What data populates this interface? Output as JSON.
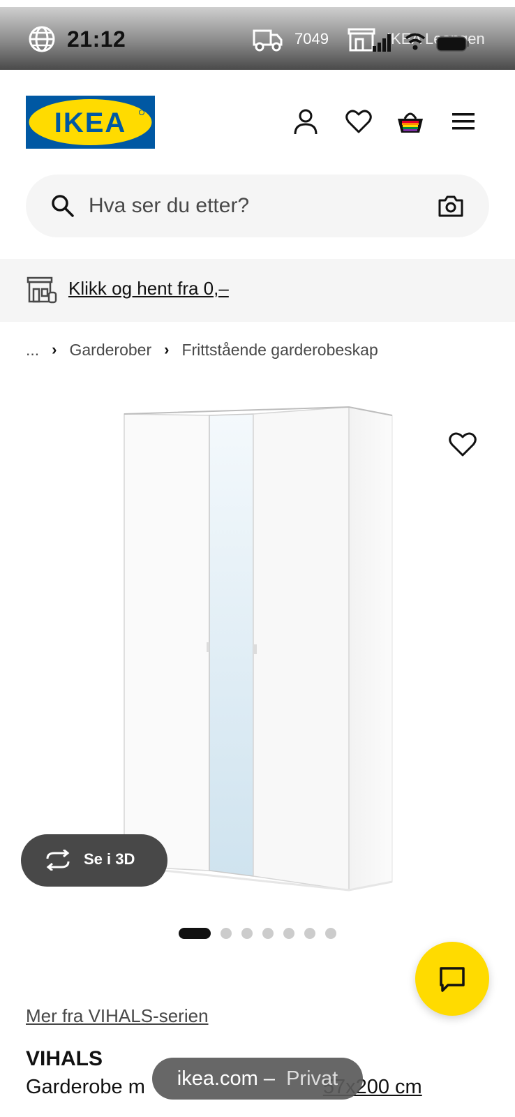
{
  "status_bar": {
    "time": "21:12",
    "delivery_count": "7049",
    "store_name": "IKEA Leangen",
    "icons": [
      "globe-icon",
      "truck-icon",
      "store-icon",
      "signal-icon",
      "wifi-icon",
      "battery-icon"
    ]
  },
  "header": {
    "logo_text": "IKEA",
    "icons": [
      "account-icon",
      "heart-icon",
      "cart-icon",
      "menu-icon"
    ]
  },
  "search": {
    "placeholder": "Hva ser du etter?",
    "value": "",
    "icons": [
      "search-icon",
      "camera-icon"
    ]
  },
  "banner": {
    "link_text": "Klikk og hent fra 0,–",
    "icon": "store-icon"
  },
  "breadcrumb": {
    "items": [
      "...",
      "Garderober",
      "Frittstående garderobeskap"
    ]
  },
  "product": {
    "view_3d_label": "Se i 3D",
    "image_count": 7,
    "active_image": 1,
    "series_link": "Mer fra VIHALS-serien",
    "name": "VIHALS",
    "desc_prefix": "Garderobe m",
    "desc_size": "57x200 cm"
  },
  "browser_toast": {
    "domain": "ikea.com",
    "separator": " – ",
    "mode": "Privat"
  },
  "colors": {
    "ikea_blue": "#0058a3",
    "ikea_yellow": "#ffdb00",
    "text_dark": "#111111",
    "surface_gray": "#f5f5f5"
  }
}
